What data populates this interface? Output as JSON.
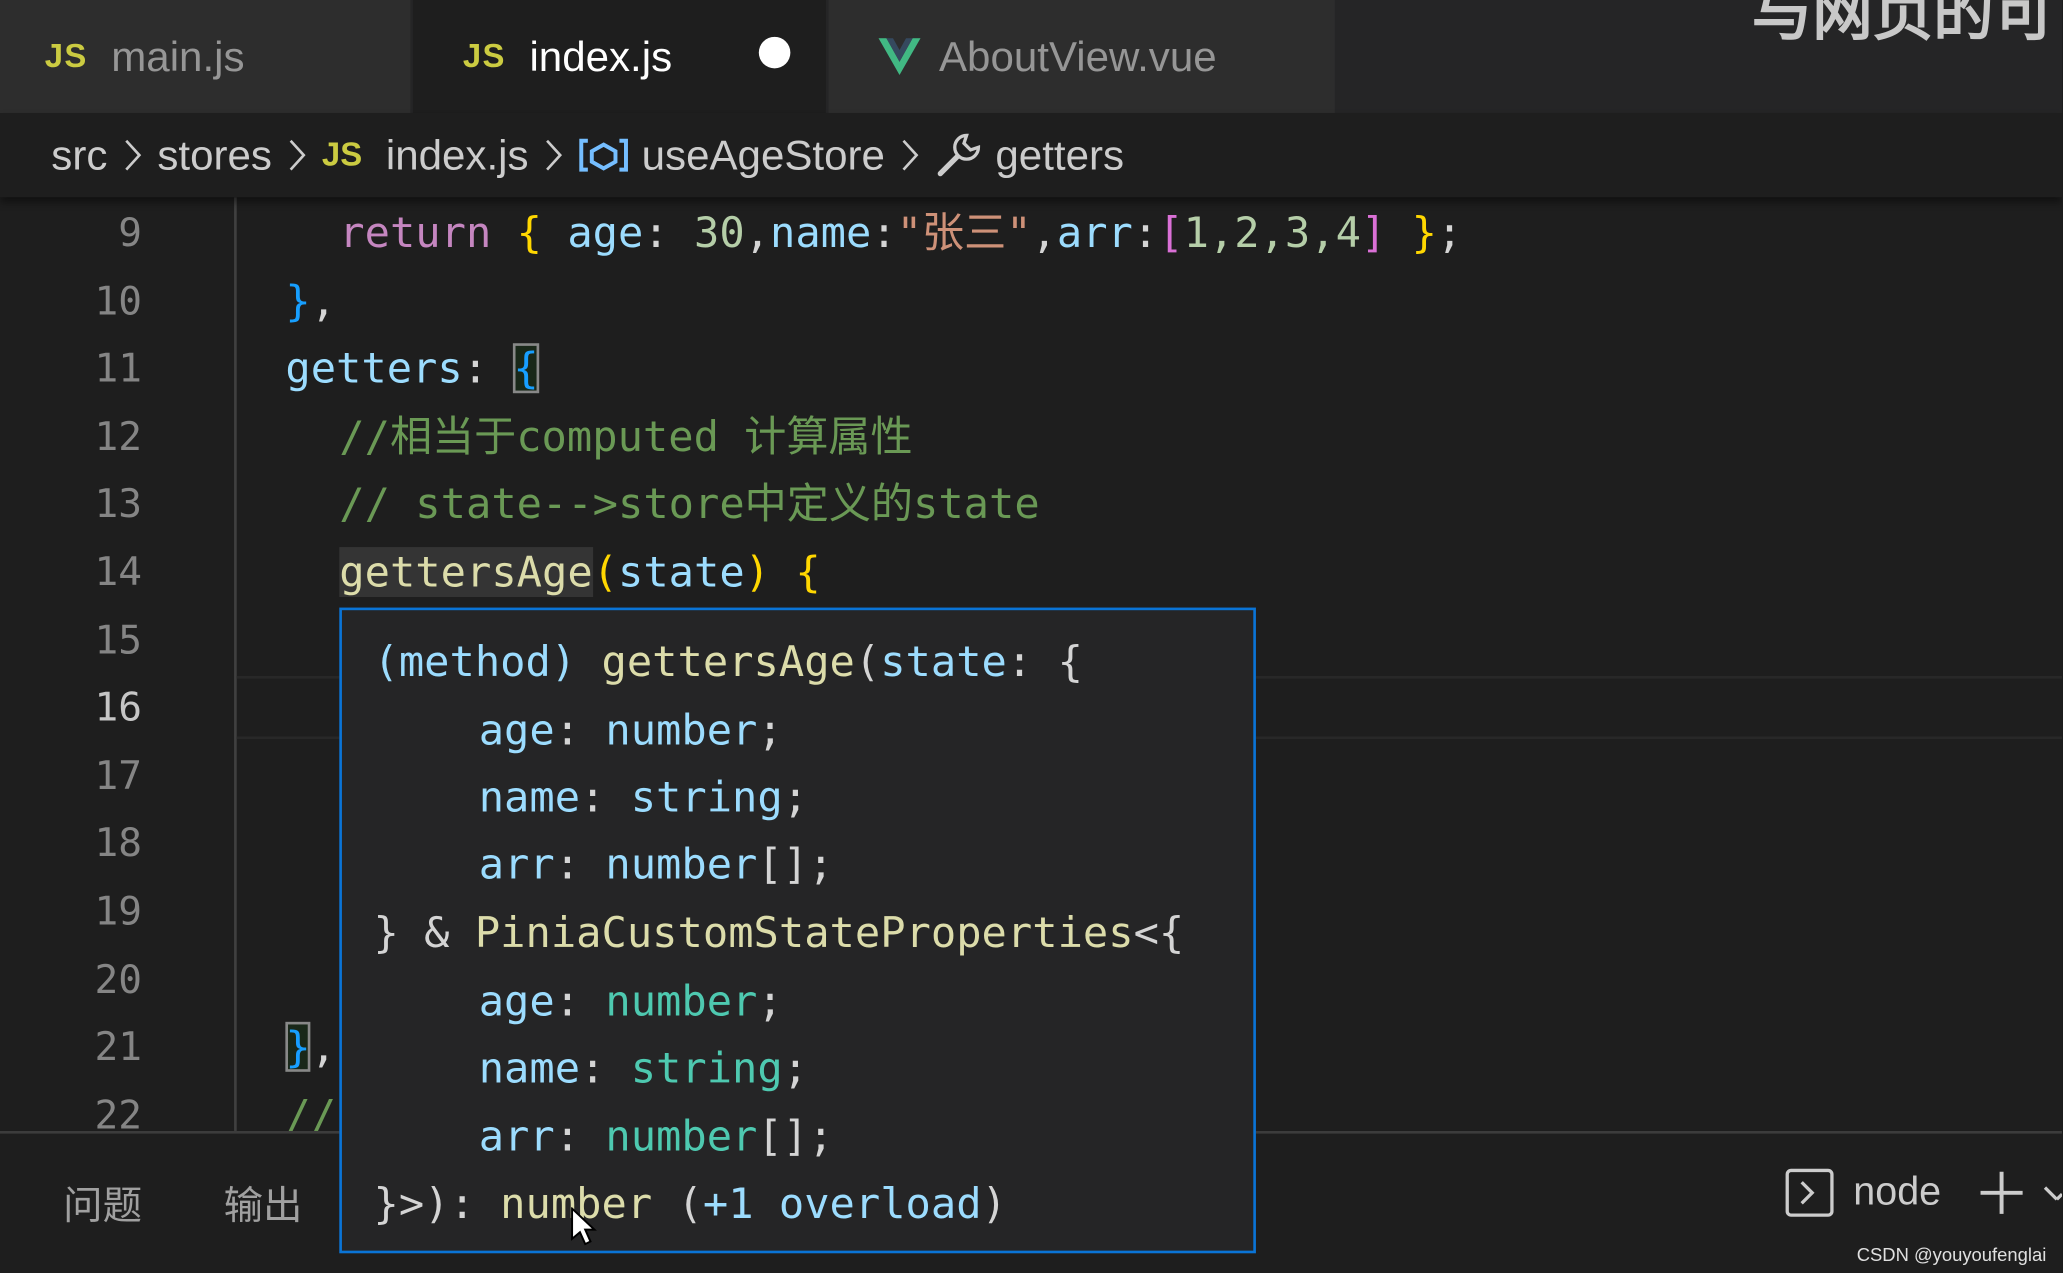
{
  "tabs": [
    {
      "icon": "JS",
      "label": "main.js"
    },
    {
      "icon": "JS",
      "label": "index.js"
    },
    {
      "icon": "vue-icon",
      "label": "AboutView.vue"
    }
  ],
  "watermark_text": "与网页的可",
  "breadcrumb": {
    "src": "src",
    "stores": "stores",
    "file_icon": "JS",
    "file": "index.js",
    "symbol": "useAgeStore",
    "member": "getters"
  },
  "line_numbers": [
    "9",
    "10",
    "11",
    "12",
    "13",
    "14",
    "15",
    "16",
    "17",
    "18",
    "19",
    "20",
    "21",
    "22"
  ],
  "code": {
    "l9": {
      "kw": "return",
      "ob": "{",
      "age_key": "age",
      "colon1": ":",
      "age_val": "30",
      "c1": ",",
      "name_key": "name",
      "colon2": ":",
      "name_val": "\"张三\"",
      "c2": ",",
      "arr_key": "arr",
      "colon3": ":",
      "arr_open": "[",
      "arr_vals": "1,2,3,4",
      "arr_close": "]",
      "cb": "}",
      "semi": ";"
    },
    "l10": {
      "brace": "}",
      "comma": ","
    },
    "l11": {
      "key": "getters",
      "colon": ":",
      "brace": "{"
    },
    "l12": "//相当于computed 计算属性",
    "l13": "// state-->store中定义的state",
    "l14": {
      "fn": "gettersAge",
      "open": "(",
      "param": "state",
      "close": ")",
      "brace": "{"
    },
    "l21": {
      "brace": "}",
      "comma": ","
    },
    "l22": "//"
  },
  "hover": {
    "l1": {
      "kw": "(method)",
      "fn": "gettersAge",
      "open": "(",
      "param": "state",
      "colon": ":",
      "brace": "{"
    },
    "l2": {
      "key": "age",
      "colon": ":",
      "type": "number",
      "semi": ";"
    },
    "l3": {
      "key": "name",
      "colon": ":",
      "type": "string",
      "semi": ";"
    },
    "l4": {
      "key": "arr",
      "colon": ":",
      "type": "number",
      "arr": "[]",
      "semi": ";"
    },
    "l5": {
      "close": "}",
      "amp": "&",
      "type": "PiniaCustomStateProperties",
      "open": "<{"
    },
    "l6": {
      "key": "age",
      "colon": ":",
      "type": "number",
      "semi": ";"
    },
    "l7": {
      "key": "name",
      "colon": ":",
      "type": "string",
      "semi": ";"
    },
    "l8": {
      "key": "arr",
      "colon": ":",
      "type": "number",
      "arr": "[]",
      "semi": ";"
    },
    "l9": {
      "close": "}>):",
      "ret": "number",
      "open": "(",
      "overload": "+1 overload",
      "close2": ")"
    }
  },
  "panel": {
    "tabs": [
      "问题",
      "输出"
    ],
    "terminal_label": "node"
  },
  "credit": "CSDN @youyoufenglai",
  "colors": {
    "accent": "#0a74d6",
    "js": "#cbcb41",
    "vue": "#41b883"
  }
}
